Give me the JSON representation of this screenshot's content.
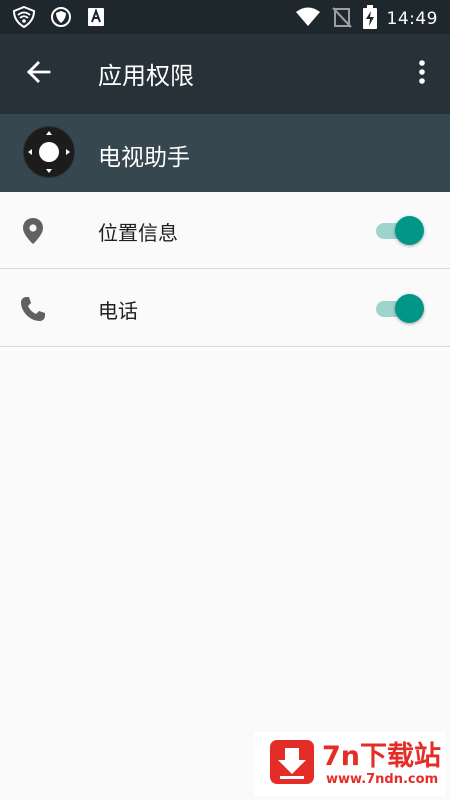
{
  "status_bar": {
    "time": "14:49",
    "left_icons": [
      "vpn-shield-icon",
      "privacy-shield-icon",
      "keyboard-a-icon"
    ],
    "right_icons": [
      "wifi-icon",
      "no-signal-icon",
      "battery-charging-icon"
    ]
  },
  "toolbar": {
    "title": "应用权限",
    "back_icon": "arrow-back-icon",
    "overflow_icon": "more-vert-icon"
  },
  "app": {
    "name": "电视助手",
    "icon": "remote-control-icon"
  },
  "permissions": [
    {
      "label": "位置信息",
      "icon": "location-pin-icon",
      "enabled": true
    },
    {
      "label": "电话",
      "icon": "phone-icon",
      "enabled": true
    }
  ],
  "watermark": {
    "title": "7n下载站",
    "url": "www.7ndn.com"
  },
  "colors": {
    "status_bar": "#1e272b",
    "toolbar": "#263238",
    "app_header": "#37474f",
    "accent": "#009688",
    "switch_track": "#9ed4cd",
    "background": "#fafafa",
    "watermark": "#e52d27"
  }
}
